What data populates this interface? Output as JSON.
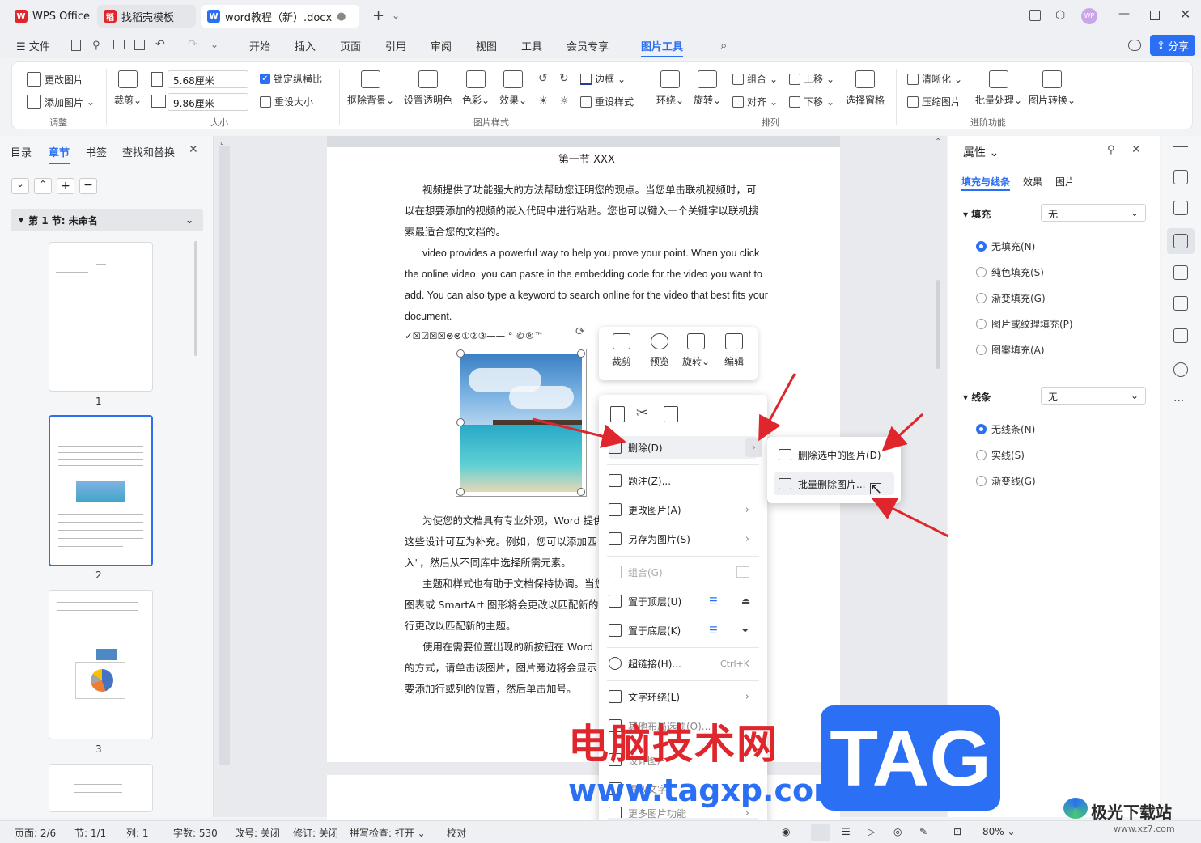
{
  "titlebar": {
    "tab1": "WPS Office",
    "tab2": "找稻壳模板",
    "tab3": "word教程（新）.docx",
    "new_tab": "+"
  },
  "menubar": {
    "file": "文件",
    "items": [
      "开始",
      "插入",
      "页面",
      "引用",
      "审阅",
      "视图",
      "工具",
      "会员专享",
      "图片工具"
    ],
    "share": "分享"
  },
  "ribbon": {
    "change_pic": "更改图片",
    "add_pic": "添加图片",
    "crop": "裁剪",
    "width": "5.68厘米",
    "height": "9.86厘米",
    "lock_ratio": "锁定纵横比",
    "reset_size": "重设大小",
    "remove_bg": "抠除背景",
    "set_transparent": "设置透明色",
    "color": "色彩",
    "effect": "效果",
    "border": "边框",
    "reset_style": "重设样式",
    "wrap": "环绕",
    "rotate": "旋转",
    "group": "组合",
    "align": "对齐",
    "bring_up": "上移",
    "send_down": "下移",
    "selection_pane": "选择窗格",
    "sharpen": "清晰化",
    "compress": "压缩图片",
    "batch": "批量处理",
    "convert": "图片转换",
    "groups": [
      "调整",
      "大小",
      "图片样式",
      "排列",
      "进阶功能"
    ]
  },
  "leftpanel": {
    "tabs": [
      "目录",
      "章节",
      "书签",
      "查找和替换"
    ],
    "section": "第 1 节: 未命名",
    "pages": [
      "1",
      "2",
      "3"
    ]
  },
  "document": {
    "heading": "第一节 XXX",
    "p1": [
      "视频提供了功能强大的方法帮助您证明您的观点。当您单击联机视频时，可",
      "以在想要添加的视频的嵌入代码中进行粘贴。您也可以键入一个关键字以联机搜",
      "索最适合您的文档的。"
    ],
    "p2": [
      "video provides a powerful way to help you prove your point. When you click",
      "the online video, you can paste in the embedding code for the video you want to",
      "add. You can also type a keyword to search online for the video that best fits your",
      "document."
    ],
    "symbols": "✓☒☑☒☒⊗⊗①②③——  °  ©®™",
    "p3": [
      "为使您的文档具有专业外观，Word 提供",
      "这些设计可互为补充。例如，您可以添加匹",
      "入\"，然后从不同库中选择所需元素。"
    ],
    "p4": [
      "主题和样式也有助于文档保持协调。当您",
      "图表或 SmartArt 图形将会更改以匹配新的",
      "行更改以匹配新的主题。"
    ],
    "p5": [
      "使用在需要位置出现的新按钮在 Word",
      "的方式，请单击该图片，图片旁边将会显示",
      "要添加行或列的位置，然后单击加号。"
    ]
  },
  "floatbar": {
    "crop": "裁剪",
    "preview": "预览",
    "rotate": "旋转",
    "edit": "编辑"
  },
  "context_menu": {
    "delete": "删除(D)",
    "caption": "题注(Z)...",
    "change": "更改图片(A)",
    "save_as": "另存为图片(S)",
    "group": "组合(G)",
    "top": "置于顶层(U)",
    "bottom": "置于底层(K)",
    "hyperlink": "超链接(H)...",
    "hyperlink_key": "Ctrl+K",
    "wrap": "文字环绕(L)",
    "other": "其他布局选项(O)...",
    "design": "设计图片",
    "extract": "提取文字",
    "more": "更多图片功能"
  },
  "submenu": {
    "delete_selected": "删除选中的图片(D)",
    "batch_delete": "批量删除图片..."
  },
  "rightpanel": {
    "title": "属性",
    "tabs": [
      "填充与线条",
      "效果",
      "图片"
    ],
    "fill": "填充",
    "fill_value": "无",
    "fill_options": [
      "无填充(N)",
      "纯色填充(S)",
      "渐变填充(G)",
      "图片或纹理填充(P)",
      "图案填充(A)"
    ],
    "line": "线条",
    "line_value": "无",
    "line_options": [
      "无线条(N)",
      "实线(S)",
      "渐变线(G)"
    ]
  },
  "status": {
    "page": "页面: 2/6",
    "section": "节: 1/1",
    "col": "列: 1",
    "words": "字数: 530",
    "revise": "改号: 关闭",
    "track": "修订: 关闭",
    "spell": "拼写检查: 打开",
    "proof": "校对",
    "zoom": "80%"
  },
  "watermark": {
    "cn": "电脑技术网",
    "url": "www.tagxp.com",
    "tag": "TAG",
    "site": "极光下载站",
    "site_url": "www.xz7.com"
  },
  "colors": {
    "accent": "#2a6ff4",
    "arrow": "#e0262d"
  }
}
